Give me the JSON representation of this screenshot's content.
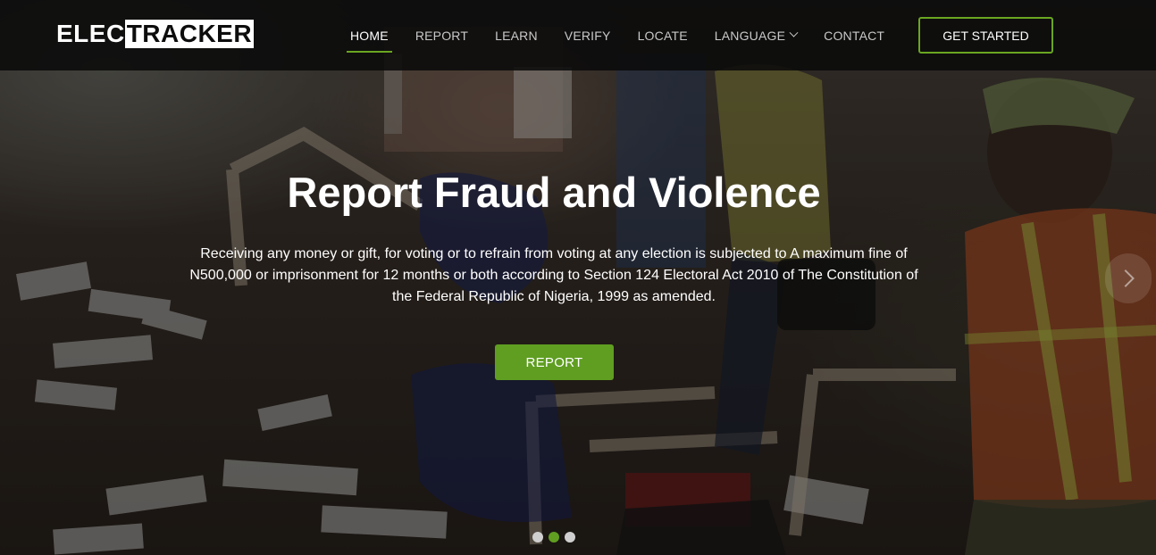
{
  "brand": {
    "part1": "ELEC",
    "part2": "TRACKER"
  },
  "nav": {
    "items": [
      {
        "label": "HOME",
        "active": true
      },
      {
        "label": "REPORT",
        "active": false
      },
      {
        "label": "LEARN",
        "active": false
      },
      {
        "label": "VERIFY",
        "active": false
      },
      {
        "label": "LOCATE",
        "active": false
      },
      {
        "label": "LANGUAGE",
        "active": false,
        "has_dropdown": true
      },
      {
        "label": "CONTACT",
        "active": false
      }
    ],
    "cta_label": "GET STARTED"
  },
  "hero": {
    "title": "Report Fraud and Violence",
    "description": "Receiving any money or gift, for voting or to refrain from voting at any election is subjected to A maximum fine of N500,000 or imprisonment for 12 months or both according to Section 124 Electoral Act 2010 of The Constitution of the Federal Republic of Nigeria, 1999 as amended.",
    "button_label": "REPORT",
    "next_icon": "chevron-right-icon",
    "slides_total": 3,
    "active_slide": 2
  },
  "colors": {
    "accent": "#6aa621",
    "button": "#5f9e21",
    "navbar": "#0a0a0a"
  }
}
